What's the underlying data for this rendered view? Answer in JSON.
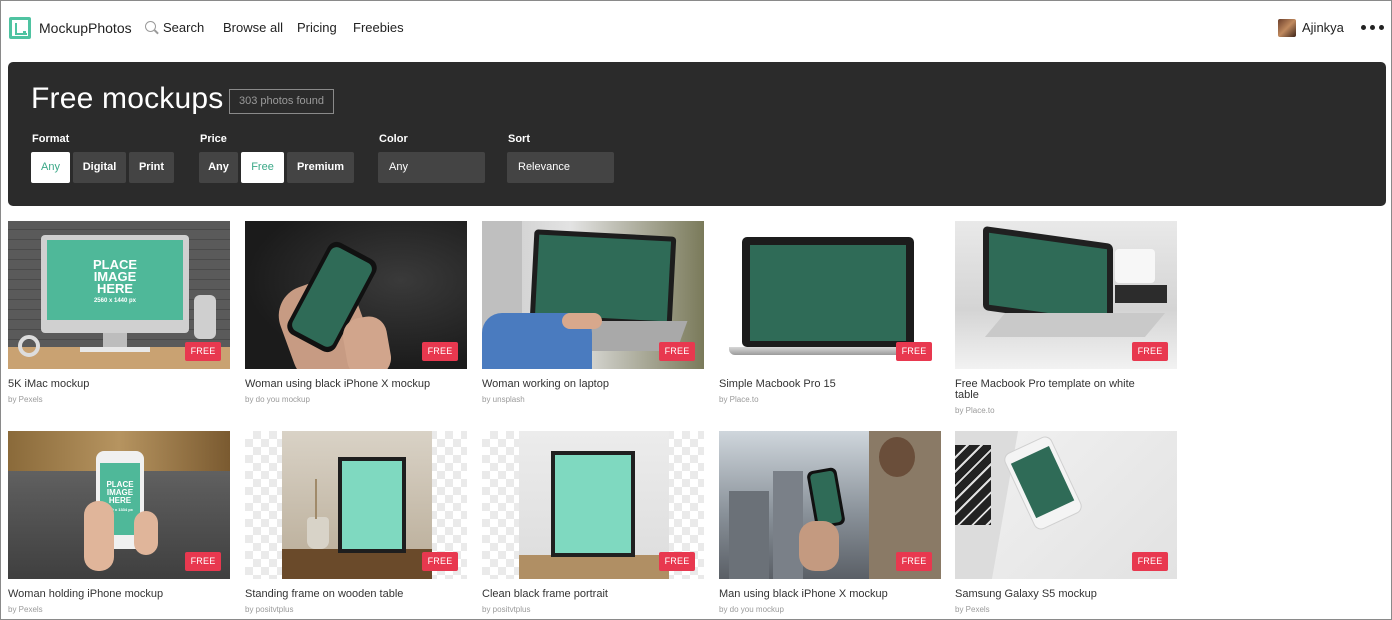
{
  "nav": {
    "brand": "MockupPhotos",
    "search_label": "Search",
    "links": [
      "Browse all",
      "Pricing",
      "Freebies"
    ],
    "username": "Ajinkya"
  },
  "panel": {
    "title": "Free mockups",
    "count": "303 photos found",
    "format": {
      "label": "Format",
      "options": [
        "Any",
        "Digital",
        "Print"
      ],
      "selected": "Any"
    },
    "price": {
      "label": "Price",
      "options": [
        "Any",
        "Free",
        "Premium"
      ],
      "selected": "Free"
    },
    "color": {
      "label": "Color",
      "value": "Any"
    },
    "sort": {
      "label": "Sort",
      "value": "Relevance"
    }
  },
  "badge_label": "FREE",
  "placeholder": {
    "line1": "PLACE",
    "line2": "IMAGE",
    "line3": "HERE",
    "dims": "2560 x 1440 px",
    "dims_phone": "750 x 1334 px"
  },
  "cards": [
    {
      "title": "5K iMac mockup",
      "by": "by Pexels"
    },
    {
      "title": "Woman using black iPhone X mockup",
      "by": "by do you mockup"
    },
    {
      "title": "Woman working on laptop",
      "by": "by unsplash"
    },
    {
      "title": "Simple Macbook Pro 15",
      "by": "by Place.to"
    },
    {
      "title": "Free Macbook Pro template on white table",
      "by": "by Place.to"
    },
    {
      "title": "Woman holding iPhone mockup",
      "by": "by Pexels"
    },
    {
      "title": "Standing frame on wooden table",
      "by": "by positvtplus"
    },
    {
      "title": "Clean black frame portrait",
      "by": "by positvtplus"
    },
    {
      "title": "Man using black iPhone X mockup",
      "by": "by do you mockup"
    },
    {
      "title": "Samsung Galaxy S5 mockup",
      "by": "by Pexels"
    }
  ],
  "colors": {
    "accent": "#4fc3a1",
    "panel": "#2b2b2b",
    "badge": "#e8384f",
    "screen": "#2f6b57"
  }
}
